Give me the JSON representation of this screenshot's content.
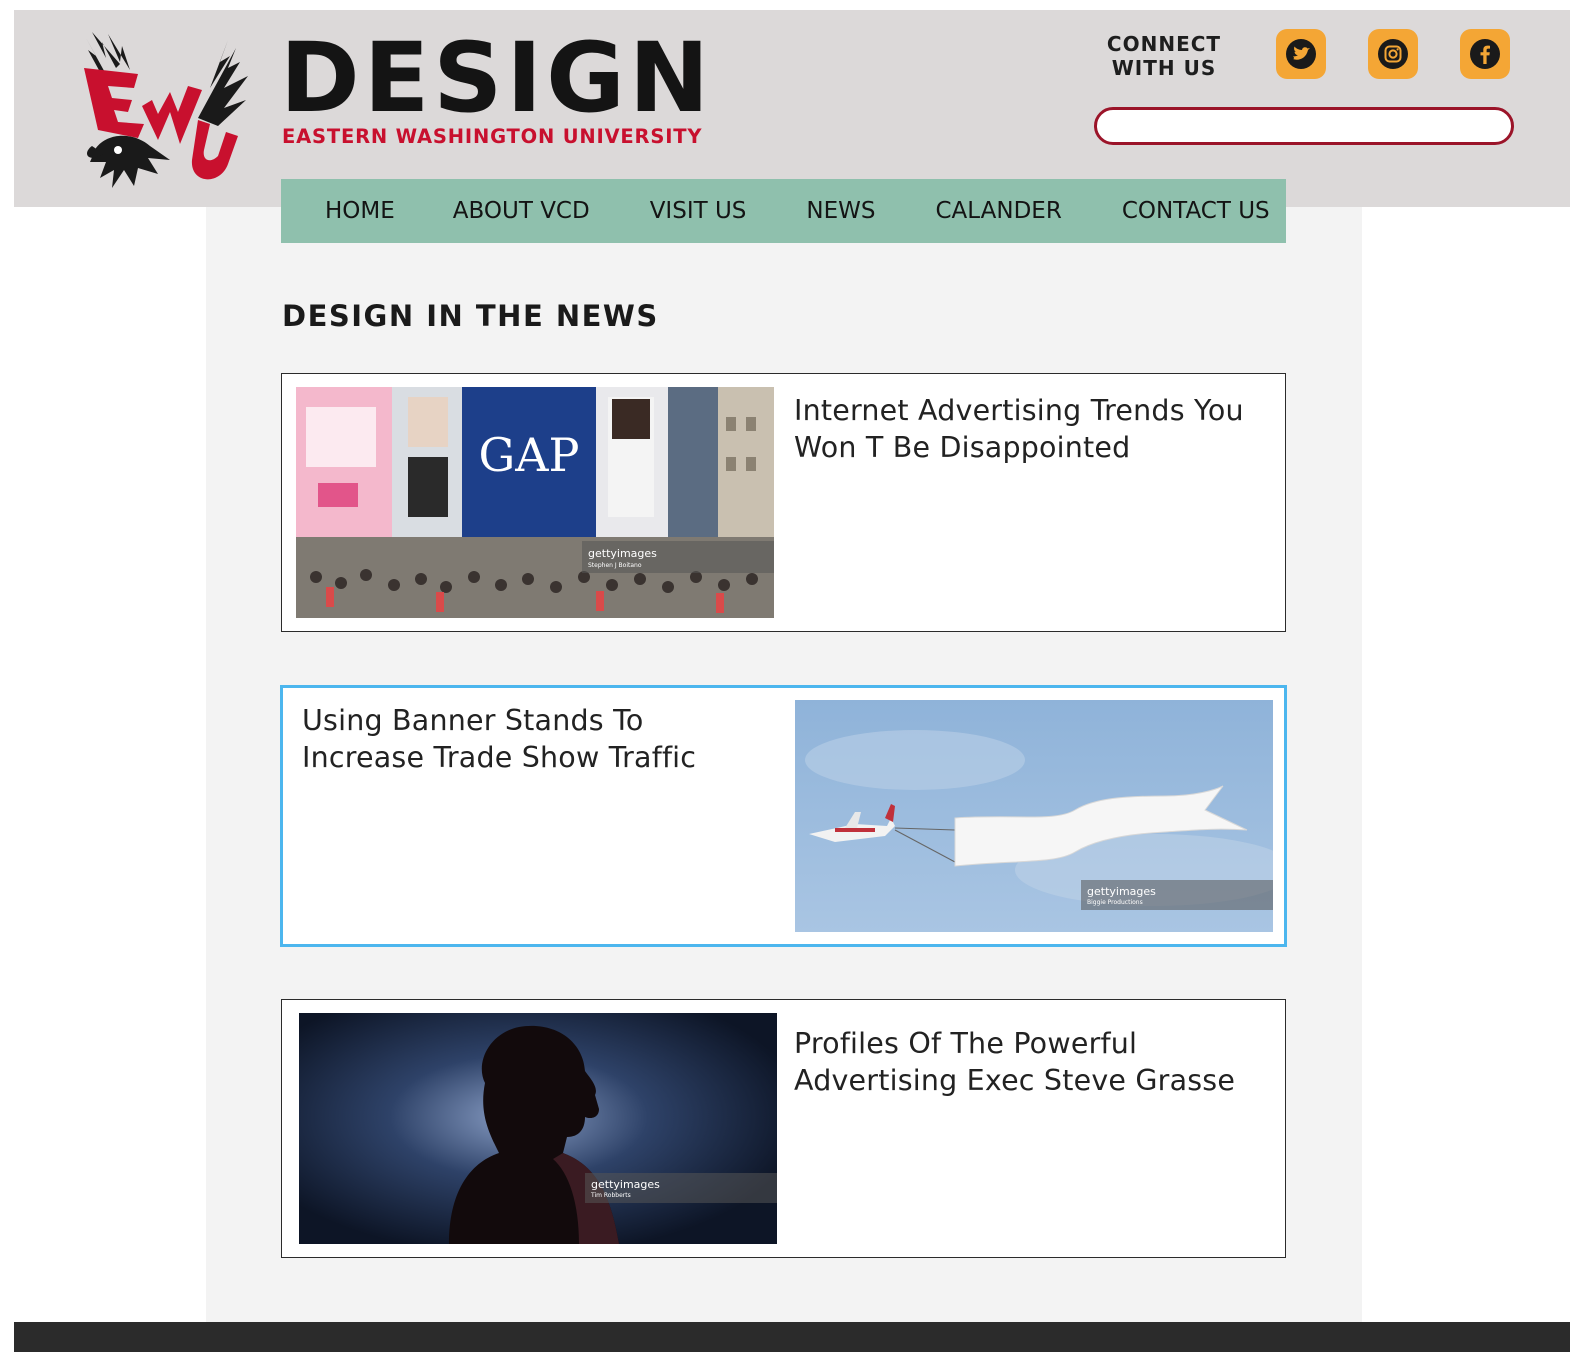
{
  "header": {
    "brand_title": "DESIGN",
    "brand_subtitle": "EASTERN WASHINGTON UNIVERSITY",
    "logo_icon": "ewu-eagle-logo",
    "connect_line1": "CONNECT",
    "connect_line2": "WITH US",
    "social": [
      {
        "name": "twitter",
        "icon": "twitter-icon"
      },
      {
        "name": "instagram",
        "icon": "instagram-icon"
      },
      {
        "name": "facebook",
        "icon": "facebook-icon"
      }
    ],
    "search_value": "",
    "colors": {
      "header_bg": "#dcd9d9",
      "brand_red": "#c8102e",
      "social_bg": "#f4a635",
      "search_border": "#9b1429"
    }
  },
  "nav": {
    "items": [
      "HOME",
      "ABOUT VCD",
      "VISIT US",
      "NEWS",
      "CALANDER",
      "CONTACT US"
    ],
    "color": "#8fc0ad"
  },
  "main": {
    "section_title": "DESIGN IN THE NEWS",
    "articles": [
      {
        "title": "Internet Advertising Trends You Won T Be Disappointed",
        "image": "city-street-billboards",
        "image_credit_brand": "gettyimages",
        "image_credit_author": "Stephen J Boitano",
        "selected": false
      },
      {
        "title": "Using Banner Stands To Increase Trade Show Traffic",
        "image": "plane-towing-banner",
        "image_credit_brand": "gettyimages",
        "image_credit_author": "Biggie Productions",
        "selected": true
      },
      {
        "title": "Profiles Of The Powerful Advertising Exec Steve Grasse",
        "image": "woman-silhouette",
        "image_credit_brand": "gettyimages",
        "image_credit_author": "Tim Robberts",
        "selected": false
      }
    ],
    "selected_border_color": "#4cb6ee"
  }
}
